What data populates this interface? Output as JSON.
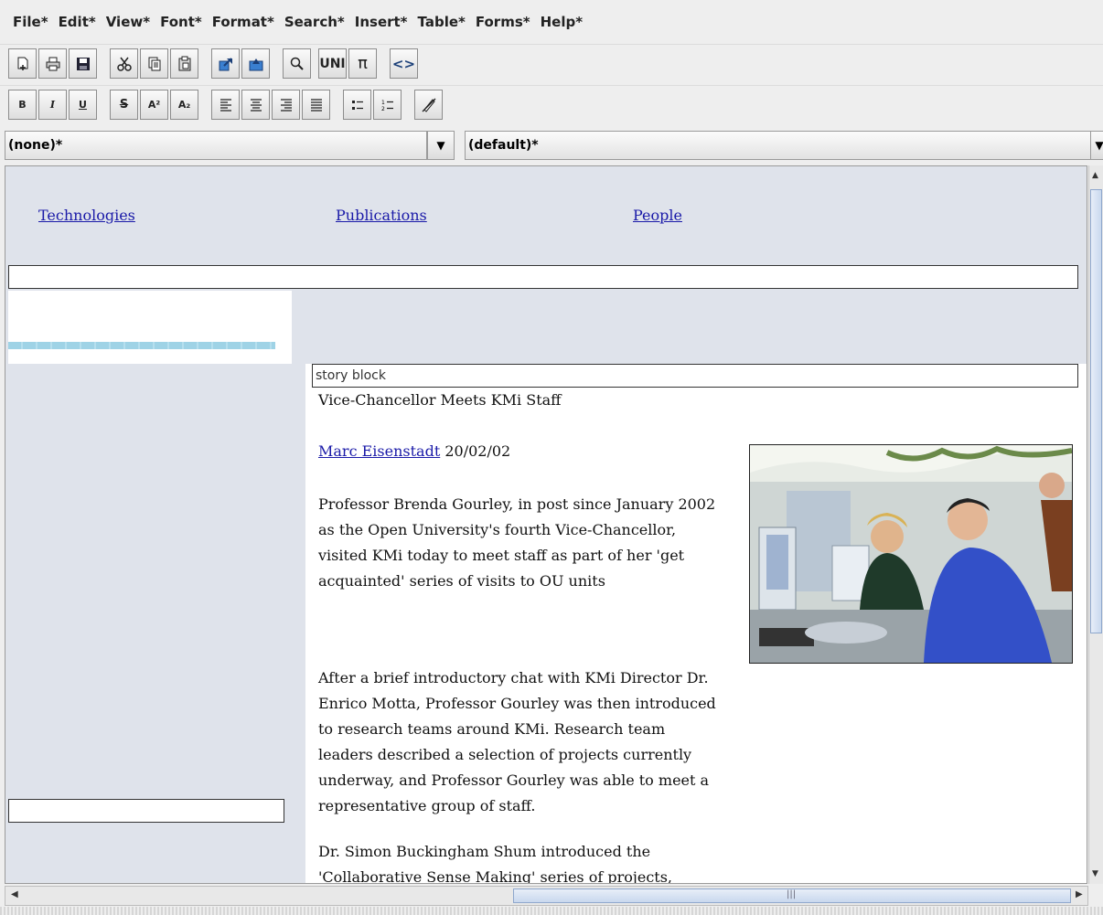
{
  "menu": [
    "File*",
    "Edit*",
    "View*",
    "Font*",
    "Format*",
    "Search*",
    "Insert*",
    "Table*",
    "Forms*",
    "Help*"
  ],
  "toolbar_icons": {
    "new": "new-document-icon",
    "print": "print-icon",
    "save": "save-icon",
    "cut": "cut-icon",
    "copy": "copy-icon",
    "paste": "paste-icon",
    "undo": "undo-icon",
    "redo": "redo-icon",
    "find": "find-icon",
    "unicode": "unicode-icon",
    "pi": "pi-icon",
    "source": "source-view-icon"
  },
  "format_toolbar": {
    "bold": "B",
    "italic": "I",
    "underline": "U",
    "strike": "S",
    "superscript": "A²",
    "subscript": "A₂"
  },
  "combos": {
    "paragraph_style": "(none)*",
    "font_face": "(default)*"
  },
  "nav_links": [
    "Technologies",
    "Publications",
    "People"
  ],
  "story": {
    "block_label": "story block",
    "title": "Vice-Chancellor Meets KMi Staff",
    "author": "Marc Eisenstadt",
    "date": "20/02/02",
    "paragraphs": [
      "Professor Brenda Gourley, in post since January 2002 as the Open University's fourth Vice-Chancellor, visited KMi today to meet staff as part of her 'get acquainted' series of visits to OU units",
      "After a brief introductory chat with KMi Director Dr. Enrico Motta, Professor Gourley was then introduced to research teams around KMi. Research team leaders described a selection of projects currently underway, and Professor Gourley was able to meet a representative group of staff.",
      "Dr. Simon Buckingham Shum introduced the 'Collaborative Sense Making' series of projects,"
    ]
  },
  "colors": {
    "link": "#1a1aa8",
    "editor_bg": "#dfe3eb",
    "dash_bar": "#9fd3e6"
  }
}
